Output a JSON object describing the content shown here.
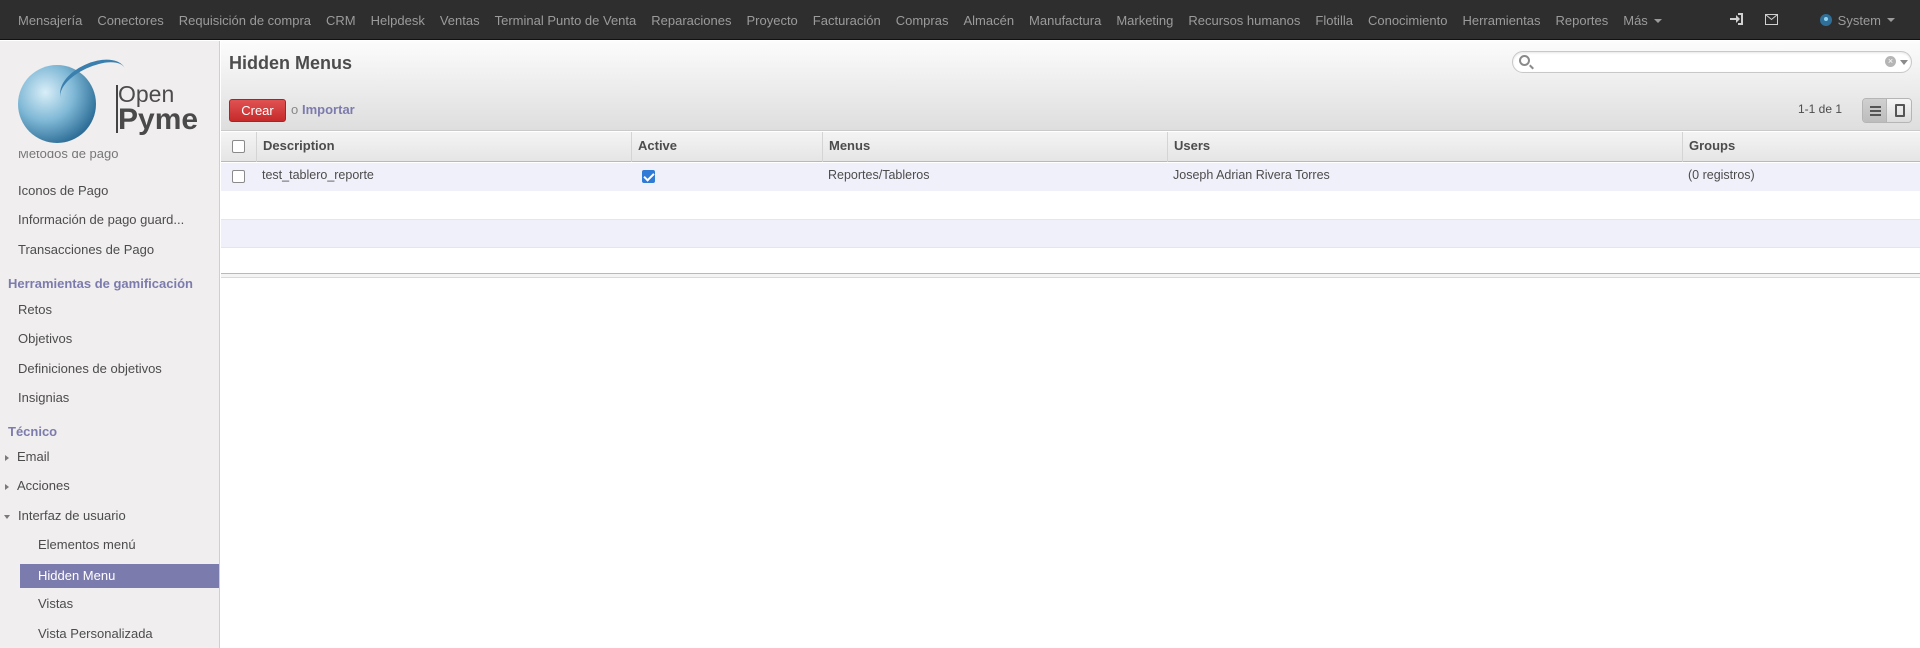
{
  "topnav": {
    "items": [
      "Mensajería",
      "Conectores",
      "Requisición de compra",
      "CRM",
      "Helpdesk",
      "Ventas",
      "Terminal Punto de Venta",
      "Reparaciones",
      "Proyecto",
      "Facturación",
      "Compras",
      "Almacén",
      "Manufactura",
      "Marketing",
      "Recursos humanos",
      "Flotilla",
      "Conocimiento",
      "Herramientas",
      "Reportes"
    ],
    "more_label": "Más",
    "user_label": "System"
  },
  "logo": {
    "line1": "Open",
    "line2": "Pyme"
  },
  "sidebar": {
    "partial_top": "Métodos de pago",
    "payment_items": [
      "Iconos de Pago",
      "Información de pago guard...",
      "Transacciones de Pago"
    ],
    "gamification_header": "Herramientas de gamificación",
    "gamification_items": [
      "Retos",
      "Objetivos",
      "Definiciones de objetivos",
      "Insignias"
    ],
    "technical_header": "Técnico",
    "technical_items": [
      "Email",
      "Acciones",
      "Interfaz de usuario"
    ],
    "ui_subitems": [
      "Elementos menú",
      "Hidden Menu",
      "Vistas",
      "Vista Personalizada"
    ]
  },
  "main": {
    "title": "Hidden Menus",
    "search_placeholder": "",
    "create_label": "Crear",
    "or_label": "o",
    "import_label": "Importar",
    "pager": "1-1 de 1"
  },
  "table": {
    "columns": [
      "Description",
      "Active",
      "Menus",
      "Users",
      "Groups"
    ],
    "rows": [
      {
        "description": "test_tablero_reporte",
        "active": true,
        "menus": "Reportes/Tableros",
        "users": "Joseph Adrian Rivera Torres",
        "groups": "(0 registros)"
      }
    ]
  }
}
